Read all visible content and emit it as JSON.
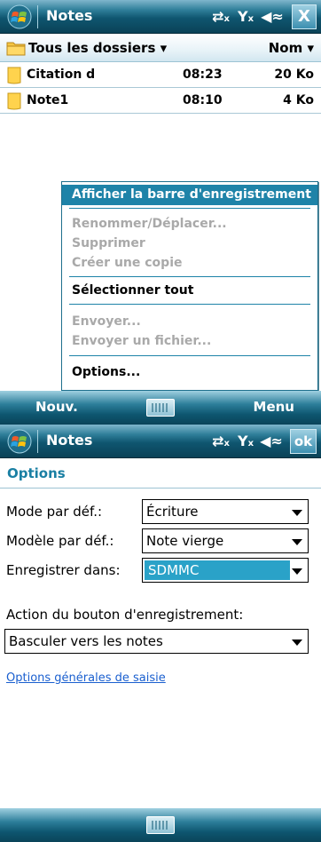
{
  "colors": {
    "title_gradient_top": "#7fb6cc",
    "title_gradient_bottom": "#0a4257",
    "menu_highlight": "#1e83a8",
    "field_highlight": "#2aa2c8",
    "options_title": "#1a7fa3",
    "link": "#1a5fcf",
    "disabled_text": "#a9a9a9"
  },
  "screen1": {
    "titlebar": {
      "app_title": "Notes",
      "close_label": "X",
      "icons": [
        "windows-flag-icon",
        "connectivity-icon",
        "signal-icon",
        "volume-icon",
        "close-icon"
      ]
    },
    "folderbar": {
      "folder_label": "Tous les dossiers ▾",
      "sort_label": "Nom ▾"
    },
    "files": [
      {
        "name": "Citation d",
        "time": "08:23",
        "size": "20 Ko"
      },
      {
        "name": "Note1",
        "time": "08:10",
        "size": "4 Ko"
      }
    ],
    "context_menu": {
      "items": [
        {
          "label": "Afficher la barre d'enregistrement",
          "state": "selected"
        },
        {
          "label": "Renommer/Déplacer...",
          "state": "disabled"
        },
        {
          "label": "Supprimer",
          "state": "disabled"
        },
        {
          "label": "Créer une copie",
          "state": "disabled"
        },
        {
          "label": "Sélectionner tout",
          "state": "enabled"
        },
        {
          "label": "Envoyer...",
          "state": "disabled"
        },
        {
          "label": "Envoyer un fichier...",
          "state": "disabled"
        },
        {
          "label": "Options...",
          "state": "enabled"
        }
      ]
    },
    "softkeys": {
      "left": "Nouv.",
      "right": "Menu"
    }
  },
  "screen2": {
    "titlebar": {
      "app_title": "Notes",
      "ok_label": "ok"
    },
    "header": {
      "title": "Options"
    },
    "fields": {
      "default_mode": {
        "label": "Mode par déf.:",
        "value": "Écriture"
      },
      "default_template": {
        "label": "Modèle par déf.:",
        "value": "Note vierge"
      },
      "save_to": {
        "label": "Enregistrer dans:",
        "value": "SDMMC"
      },
      "record_button_action": {
        "label": "Action du bouton d'enregistrement:",
        "value": "Basculer vers les notes"
      }
    },
    "link": "Options générales de saisie"
  }
}
